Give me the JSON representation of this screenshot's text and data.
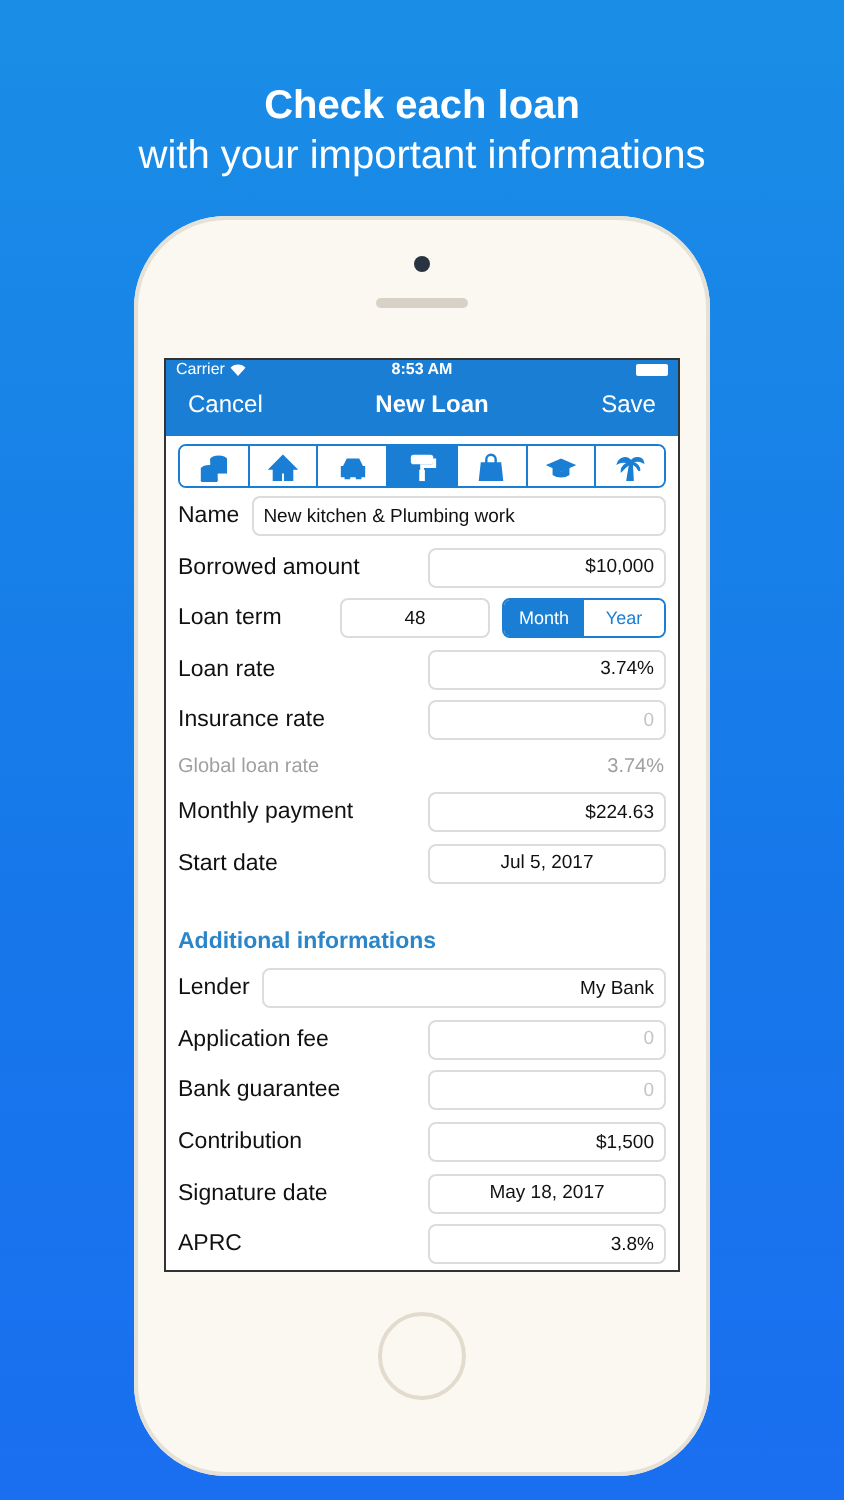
{
  "headline": {
    "title": "Check each loan",
    "subtitle": "with your important informations"
  },
  "status_bar": {
    "carrier": "Carrier",
    "time": "8:53 AM"
  },
  "nav": {
    "left": "Cancel",
    "title": "New Loan",
    "right": "Save"
  },
  "categories": [
    {
      "kind": "coins",
      "selected": false
    },
    {
      "kind": "house",
      "selected": false
    },
    {
      "kind": "car",
      "selected": false
    },
    {
      "kind": "roller",
      "selected": true
    },
    {
      "kind": "bag",
      "selected": false
    },
    {
      "kind": "cap",
      "selected": false
    },
    {
      "kind": "palm",
      "selected": false
    }
  ],
  "rows": [
    {
      "kind": "name",
      "label": "Name",
      "value": "New kitchen & Plumbing work"
    },
    {
      "kind": "field",
      "label": "Borrowed amount",
      "value": "$10,000"
    },
    {
      "kind": "term",
      "label": "Loan term",
      "value": "48",
      "segments": [
        {
          "label": "Month",
          "selected": true
        },
        {
          "label": "Year",
          "selected": false
        }
      ]
    },
    {
      "kind": "field",
      "label": "Loan rate",
      "value": "3.74%"
    },
    {
      "kind": "field",
      "label": "Insurance rate",
      "placeholder": "0"
    },
    {
      "kind": "info",
      "label": "Global loan rate",
      "value": "3.74%"
    },
    {
      "kind": "field",
      "label": "Monthly payment",
      "value": "$224.63"
    },
    {
      "kind": "date",
      "label": "Start date",
      "value": "Jul 5, 2017"
    },
    {
      "kind": "section",
      "label": "Additional informations"
    },
    {
      "kind": "wide",
      "label": "Lender",
      "value": "My Bank"
    },
    {
      "kind": "field",
      "label": "Application fee",
      "placeholder": "0"
    },
    {
      "kind": "field",
      "label": "Bank guarantee",
      "placeholder": "0"
    },
    {
      "kind": "field",
      "label": "Contribution",
      "value": "$1,500"
    },
    {
      "kind": "date",
      "label": "Signature date",
      "value": "May 18, 2017"
    },
    {
      "kind": "field",
      "label": "APRC",
      "value": "3.8%"
    }
  ]
}
